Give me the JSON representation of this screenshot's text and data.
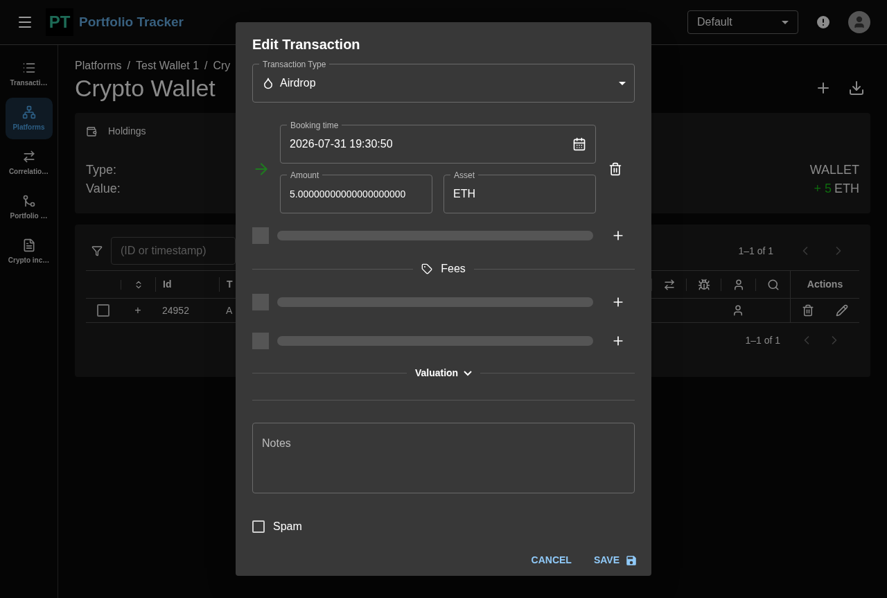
{
  "app_bar": {
    "title": "Portfolio Tracker",
    "logo_text": "PT",
    "portfolio_select": "Default"
  },
  "sidebar": {
    "items": [
      {
        "label": "Transacti…",
        "selected": false
      },
      {
        "label": "Platforms",
        "selected": true
      },
      {
        "label": "Correlatio…",
        "selected": false
      },
      {
        "label": "Portfolio …",
        "selected": false
      },
      {
        "label": "Crypto inc…",
        "selected": false
      }
    ]
  },
  "breadcrumbs": [
    {
      "label": "Platforms"
    },
    {
      "separator": "/",
      "label": "Test Wallet 1"
    },
    {
      "separator": "/",
      "label": "Cry"
    }
  ],
  "page_title": "Crypto Wallet",
  "holdings": {
    "title": "Holdings",
    "labels": [
      "Type:",
      "Value:"
    ],
    "type_value": "WALLET",
    "value_sign": "+ 5",
    "value_unit": "ETH"
  },
  "table": {
    "filter_placeholder": "(ID or timestamp)",
    "pagination": "1–1 of 1",
    "columns": [
      {
        "kind": "check"
      },
      {
        "kind": "sort"
      },
      {
        "kind": "text",
        "label": "Id"
      },
      {
        "kind": "text",
        "label": "T"
      },
      {
        "kind": "icon"
      },
      {
        "kind": "icon"
      },
      {
        "kind": "icon"
      },
      {
        "kind": "icon"
      },
      {
        "kind": "actions",
        "label": "Actions"
      }
    ],
    "rows": [
      {
        "checked": false,
        "expand": "+",
        "id": "24952",
        "type": "A"
      }
    ],
    "footer_pagination": "1–1 of 1"
  },
  "dialog": {
    "title": "Edit Transaction",
    "type_label": "Transaction Type",
    "type_value": "Airdrop",
    "transfers": [
      {
        "incoming": true,
        "booking_label": "Booking time",
        "booking_value": "2026-07-31 19:30:50",
        "amount_label": "Amount",
        "amount_value": "5.00000000000000000000",
        "asset_label": "Asset",
        "asset_value": "ETH"
      }
    ],
    "fees_label": "Fees",
    "valuation_label": "Valuation",
    "valuation_expanded": false,
    "notes_placeholder": "Notes",
    "spam": {
      "label": "Spam",
      "checked": false
    },
    "buttons": {
      "cancel": "CANCEL",
      "save": "SAVE"
    }
  }
}
